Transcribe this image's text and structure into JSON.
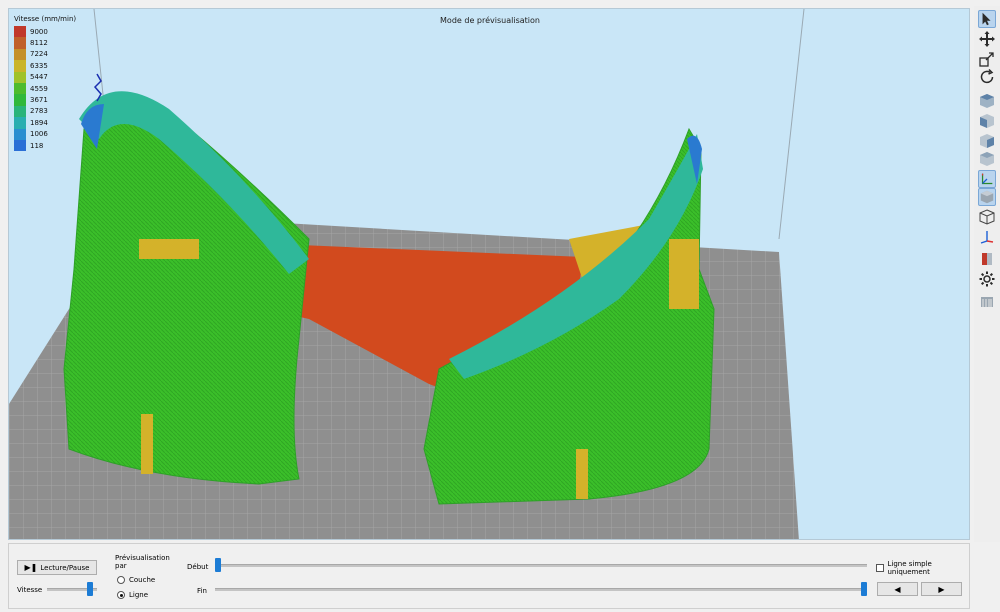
{
  "viewport": {
    "mode_title": "Mode de prévisualisation"
  },
  "legend": {
    "title": "Vitesse (mm/min)",
    "entries": [
      {
        "value": "9000",
        "color": "#c0392b"
      },
      {
        "value": "8112",
        "color": "#c0612b"
      },
      {
        "value": "7224",
        "color": "#c4902a"
      },
      {
        "value": "6335",
        "color": "#c9b52a"
      },
      {
        "value": "5447",
        "color": "#9fc22a"
      },
      {
        "value": "4559",
        "color": "#4cbb2d"
      },
      {
        "value": "3671",
        "color": "#2fb83b"
      },
      {
        "value": "2783",
        "color": "#2ab47a"
      },
      {
        "value": "1894",
        "color": "#2aaeb0"
      },
      {
        "value": "1006",
        "color": "#2a8fd0"
      },
      {
        "value": "118",
        "color": "#2a6fd6"
      }
    ]
  },
  "toolbar": {
    "items": [
      {
        "name": "select-icon",
        "active": true
      },
      {
        "name": "move-icon",
        "active": false
      },
      {
        "name": "scale-icon",
        "active": false
      },
      {
        "name": "rotate-icon",
        "active": false
      },
      {
        "name": "view-top-icon",
        "active": false
      },
      {
        "name": "view-front-icon",
        "active": false
      },
      {
        "name": "view-side-icon",
        "active": false
      },
      {
        "name": "view-back-icon",
        "active": false
      },
      {
        "name": "axes-icon",
        "active": true
      },
      {
        "name": "solid-cube-icon",
        "active": true
      },
      {
        "name": "wireframe-cube-icon",
        "active": false
      },
      {
        "name": "axis-z-icon",
        "active": false
      },
      {
        "name": "section-icon",
        "active": false
      },
      {
        "name": "gear-icon",
        "active": false
      },
      {
        "name": "supports-icon",
        "active": false
      }
    ]
  },
  "controls": {
    "play_pause_label": "Lecture/Pause",
    "speed_label": "Vitesse",
    "speed_value": 0.9,
    "preview_by_label": "Prévisualisation par",
    "radio_layer_label": "Couche",
    "radio_line_label": "Ligne",
    "selected": "Ligne",
    "debut_label": "Début",
    "fin_label": "Fin",
    "debut_value": 0,
    "fin_value": 1,
    "simple_line_label": "Ligne simple uniquement",
    "simple_line_checked": false
  }
}
